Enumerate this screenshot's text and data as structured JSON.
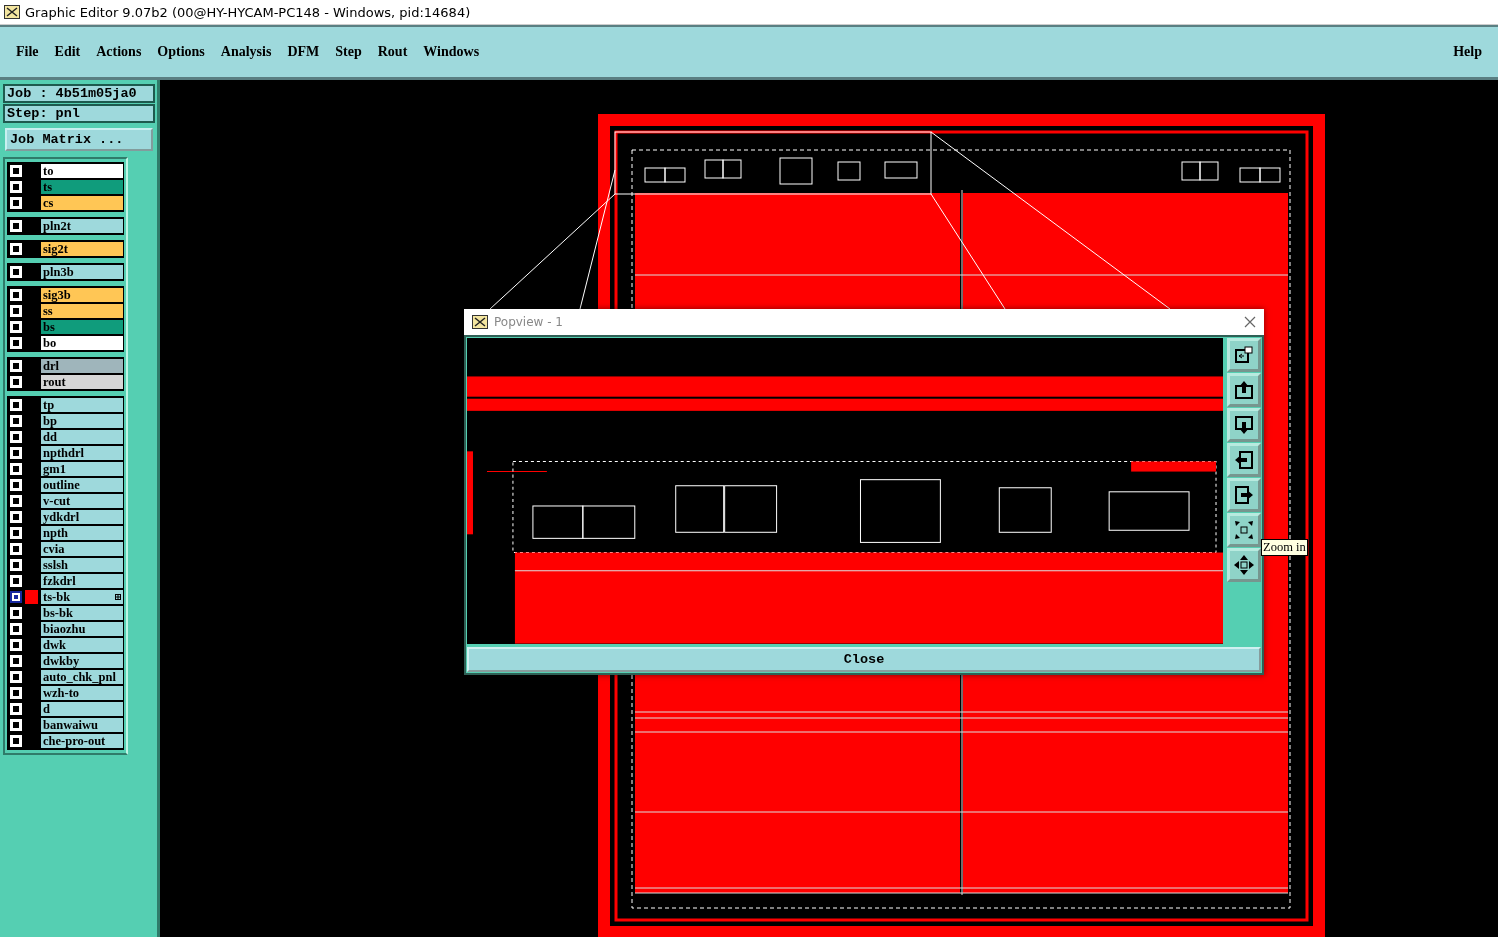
{
  "window": {
    "title": "Graphic Editor 9.07b2 (00@HY-HYCAM-PC148 - Windows, pid:14684)"
  },
  "menu": [
    "File",
    "Edit",
    "Actions",
    "Options",
    "Analysis",
    "DFM",
    "Step",
    "Rout",
    "Windows"
  ],
  "help": "Help",
  "job": {
    "job_label": "Job : 4b51m05ja0",
    "step_label": "Step: pnl",
    "matrix_button": "Job Matrix ..."
  },
  "layer_groups": [
    [
      {
        "name": "to",
        "color": "#ffffff",
        "selected": false
      },
      {
        "name": "ts",
        "color": "#109c7c",
        "selected": false
      },
      {
        "name": "cs",
        "color": "#ffc655",
        "selected": false
      }
    ],
    [
      {
        "name": "pln2t",
        "color": "#9ed9dc",
        "selected": false
      }
    ],
    [
      {
        "name": "sig2t",
        "color": "#ffc655",
        "selected": false
      }
    ],
    [
      {
        "name": "pln3b",
        "color": "#9ed9dc",
        "selected": false
      }
    ],
    [
      {
        "name": "sig3b",
        "color": "#ffc655",
        "selected": false
      },
      {
        "name": "ss",
        "color": "#ffc655",
        "selected": false
      },
      {
        "name": "bs",
        "color": "#109c7c",
        "selected": false
      },
      {
        "name": "bo",
        "color": "#ffffff",
        "selected": false
      }
    ],
    [
      {
        "name": "drl",
        "color": "#9fb5bb",
        "selected": false
      },
      {
        "name": "rout",
        "color": "#d6d6d6",
        "selected": false
      }
    ],
    [
      {
        "name": "tp",
        "color": "#9ed9dc",
        "selected": false
      },
      {
        "name": "bp",
        "color": "#9ed9dc",
        "selected": false
      },
      {
        "name": "dd",
        "color": "#9ed9dc",
        "selected": false
      },
      {
        "name": "npthdrl",
        "color": "#9ed9dc",
        "selected": false
      },
      {
        "name": "gm1",
        "color": "#9ed9dc",
        "selected": false
      },
      {
        "name": "outline",
        "color": "#9ed9dc",
        "selected": false
      },
      {
        "name": "v-cut",
        "color": "#9ed9dc",
        "selected": false
      },
      {
        "name": "ydkdrl",
        "color": "#9ed9dc",
        "selected": false
      },
      {
        "name": "npth",
        "color": "#9ed9dc",
        "selected": false
      },
      {
        "name": "cvia",
        "color": "#9ed9dc",
        "selected": false
      },
      {
        "name": "sslsh",
        "color": "#9ed9dc",
        "selected": false
      },
      {
        "name": "fzkdrl",
        "color": "#9ed9dc",
        "selected": false
      },
      {
        "name": "ts-bk",
        "color": "#9ed9dc",
        "selected": true
      },
      {
        "name": "bs-bk",
        "color": "#9ed9dc",
        "selected": false
      },
      {
        "name": "biaozhu",
        "color": "#9ed9dc",
        "selected": false
      },
      {
        "name": "dwk",
        "color": "#9ed9dc",
        "selected": false
      },
      {
        "name": "dwkby",
        "color": "#9ed9dc",
        "selected": false
      },
      {
        "name": "auto_chk_pnl",
        "color": "#9ed9dc",
        "selected": false
      },
      {
        "name": "wzh-to",
        "color": "#9ed9dc",
        "selected": false
      },
      {
        "name": "d",
        "color": "#9ed9dc",
        "selected": false
      },
      {
        "name": "banwaiwu",
        "color": "#9ed9dc",
        "selected": false
      },
      {
        "name": "che-pro-out",
        "color": "#9ed9dc",
        "selected": false
      }
    ]
  ],
  "popview": {
    "title": "Popview - 1",
    "close_button": "Close",
    "tooltip": "Zoom in"
  }
}
